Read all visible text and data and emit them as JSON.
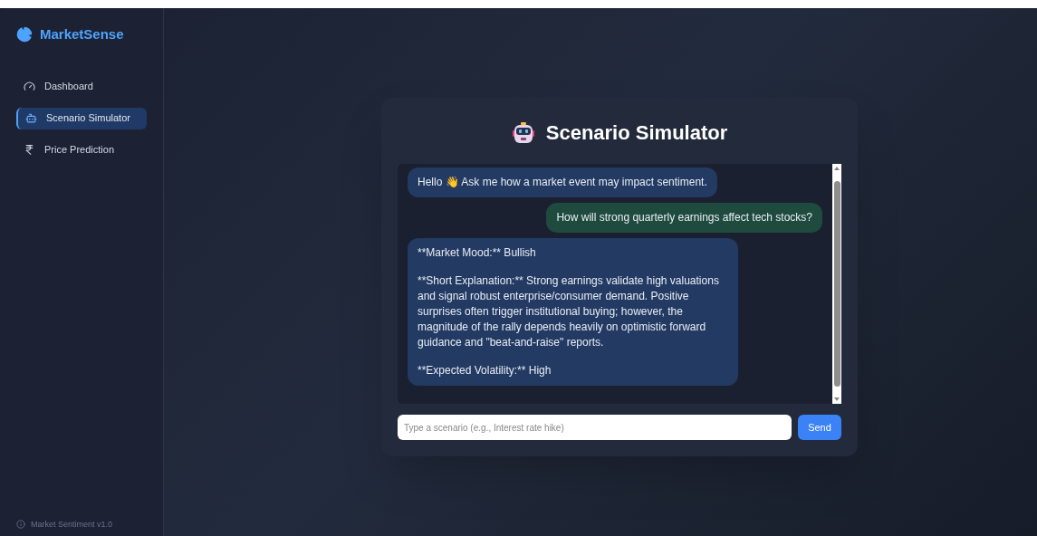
{
  "sidebar": {
    "brand": "MarketSense",
    "items": [
      {
        "label": "Dashboard",
        "kind": "gauge",
        "selected": false
      },
      {
        "label": "Scenario Simulator",
        "kind": "bot",
        "selected": true
      },
      {
        "label": "Price Prediction",
        "kind": "rupee",
        "selected": false
      }
    ],
    "footer": "Market Sentiment v1.0"
  },
  "panel": {
    "title": "Scenario Simulator",
    "messages": [
      {
        "kind": "bot",
        "paragraphs": [
          "Hello 👋 Ask me how a market event may impact sentiment."
        ]
      },
      {
        "kind": "user",
        "paragraphs": [
          "How will strong quarterly earnings affect tech stocks?"
        ]
      },
      {
        "kind": "bot",
        "paragraphs": [
          "**Market Mood:** Bullish",
          "**Short Explanation:** Strong earnings validate high valuations and signal robust enterprise/consumer demand. Positive surprises often trigger institutional buying; however, the magnitude of the rally depends heavily on optimistic forward guidance and \"beat-and-raise\" reports.",
          "**Expected Volatility:** High"
        ]
      }
    ],
    "input": {
      "placeholder": "Type a scenario (e.g., Interest rate hike)"
    },
    "send": "Send"
  }
}
